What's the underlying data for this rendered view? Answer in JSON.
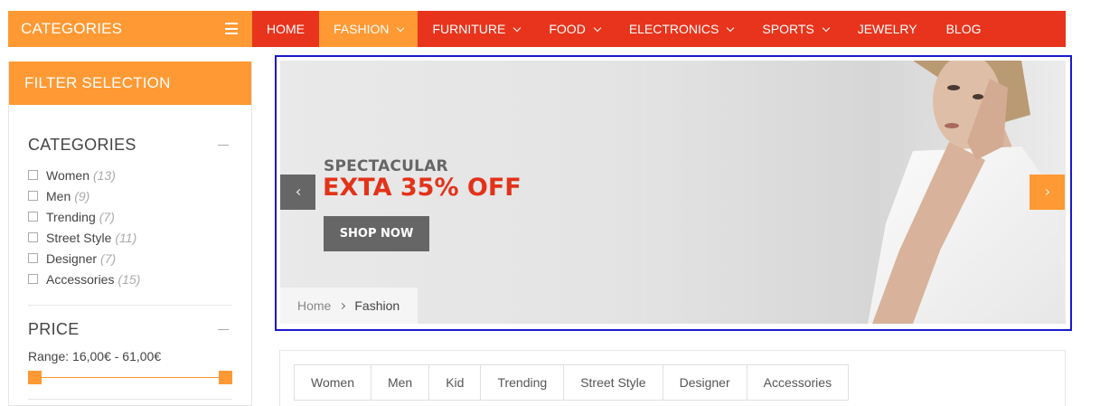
{
  "categories_bar": {
    "label": "CATEGORIES",
    "menu_icon": "hamburger-icon"
  },
  "nav": {
    "items": [
      {
        "label": "HOME",
        "dropdown": false
      },
      {
        "label": "FASHION",
        "dropdown": true,
        "active": true
      },
      {
        "label": "FURNITURE",
        "dropdown": true
      },
      {
        "label": "FOOD",
        "dropdown": true
      },
      {
        "label": "ELECTRONICS",
        "dropdown": true
      },
      {
        "label": "SPORTS",
        "dropdown": true
      },
      {
        "label": "JEWELRY",
        "dropdown": false
      },
      {
        "label": "BLOG",
        "dropdown": false
      }
    ]
  },
  "sidebar": {
    "title": "FILTER SELECTION",
    "categories": {
      "title": "CATEGORIES",
      "items": [
        {
          "label": "Women",
          "count": "(13)"
        },
        {
          "label": "Men",
          "count": "(9)"
        },
        {
          "label": "Trending",
          "count": "(7)"
        },
        {
          "label": "Street Style",
          "count": "(11)"
        },
        {
          "label": "Designer",
          "count": "(7)"
        },
        {
          "label": "Accessories",
          "count": "(15)"
        }
      ]
    },
    "price": {
      "title": "PRICE",
      "range_text": "Range: 16,00€ - 61,00€",
      "min": 16,
      "max": 61,
      "slider_low_fraction": 0,
      "slider_high_fraction": 1
    }
  },
  "banner": {
    "eyebrow": "SPECTACULAR",
    "headline": "EXTA 35% OFF",
    "cta": "SHOP NOW",
    "prev_icon": "chevron-left-icon",
    "next_icon": "chevron-right-icon"
  },
  "breadcrumb": {
    "home": "Home",
    "current": "Fashion"
  },
  "tabs": [
    "Women",
    "Men",
    "Kid",
    "Trending",
    "Street Style",
    "Designer",
    "Accessories"
  ],
  "colors": {
    "accent_orange": "#ff9933",
    "nav_red": "#e8341c",
    "promo_red": "#e2331a",
    "button_gray": "#666666"
  }
}
